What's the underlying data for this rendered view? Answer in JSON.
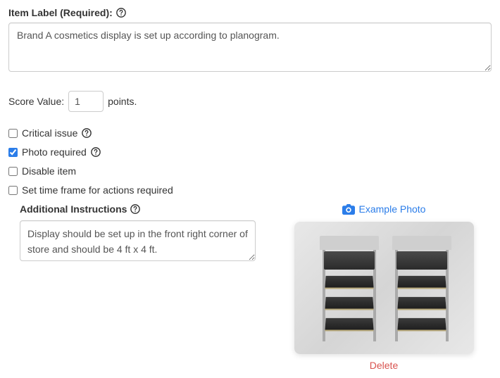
{
  "itemLabel": {
    "label": "Item Label (Required):",
    "value": "Brand A cosmetics display is set up according to planogram."
  },
  "score": {
    "label": "Score Value:",
    "value": "1",
    "suffix": "points."
  },
  "checkboxes": {
    "critical": {
      "label": "Critical issue",
      "checked": false
    },
    "photo": {
      "label": "Photo required",
      "checked": true
    },
    "disable": {
      "label": "Disable item",
      "checked": false
    },
    "timeframe": {
      "label": "Set time frame for actions required",
      "checked": false
    }
  },
  "additional": {
    "label": "Additional Instructions",
    "value": "Display should be set up in the front right corner of store and should be 4 ft x 4 ft."
  },
  "examplePhoto": {
    "linkLabel": "Example Photo",
    "deleteLabel": "Delete"
  }
}
